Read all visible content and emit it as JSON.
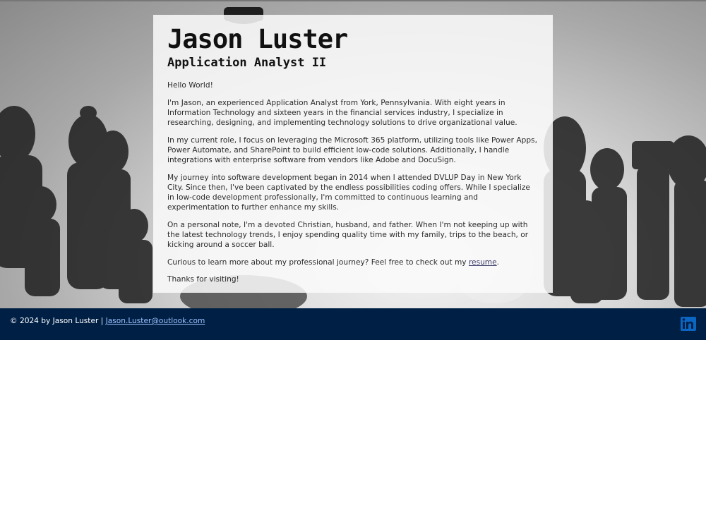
{
  "profile": {
    "name": "Jason Luster",
    "title": "Application Analyst II"
  },
  "content": {
    "greeting": "Hello World!",
    "paragraph_intro": "I'm Jason, an experienced Application Analyst from York, Pennsylvania. With eight years in Information Technology and sixteen years in the financial services industry, I specialize in researching, designing, and implementing technology solutions to drive organizational value.",
    "paragraph_role": "In my current role, I focus on leveraging the Microsoft 365 platform, utilizing tools like Power Apps, Power Automate, and SharePoint to build efficient low-code solutions. Additionally, I handle integrations with enterprise software from vendors like Adobe and DocuSign.",
    "paragraph_journey": "My journey into software development began in 2014 when I attended DVLUP Day in New York City. Since then, I've been captivated by the endless possibilities coding offers. While I specialize in low-code development professionally, I'm committed to continuous learning and experimentation to further enhance my skills.",
    "paragraph_personal": "On a personal note, I'm a devoted Christian, husband, and father. When I'm not keeping up with the latest technology trends, I enjoy spending quality time with my family, trips to the beach, or kicking around a soccer ball.",
    "resume_prefix": "Curious to learn more about my professional journey? Feel free to check out my ",
    "resume_link": "resume",
    "resume_suffix": ".",
    "closing": "Thanks for visiting!"
  },
  "footer": {
    "copyright": "© 2024 by Jason Luster | ",
    "email": "Jason.Luster@outlook.com",
    "social_icon": "linkedin-icon"
  },
  "colors": {
    "footer_bg": "#001f45",
    "link_footer": "#9cc3ff",
    "linkedin_blue": "#0a66c2"
  }
}
